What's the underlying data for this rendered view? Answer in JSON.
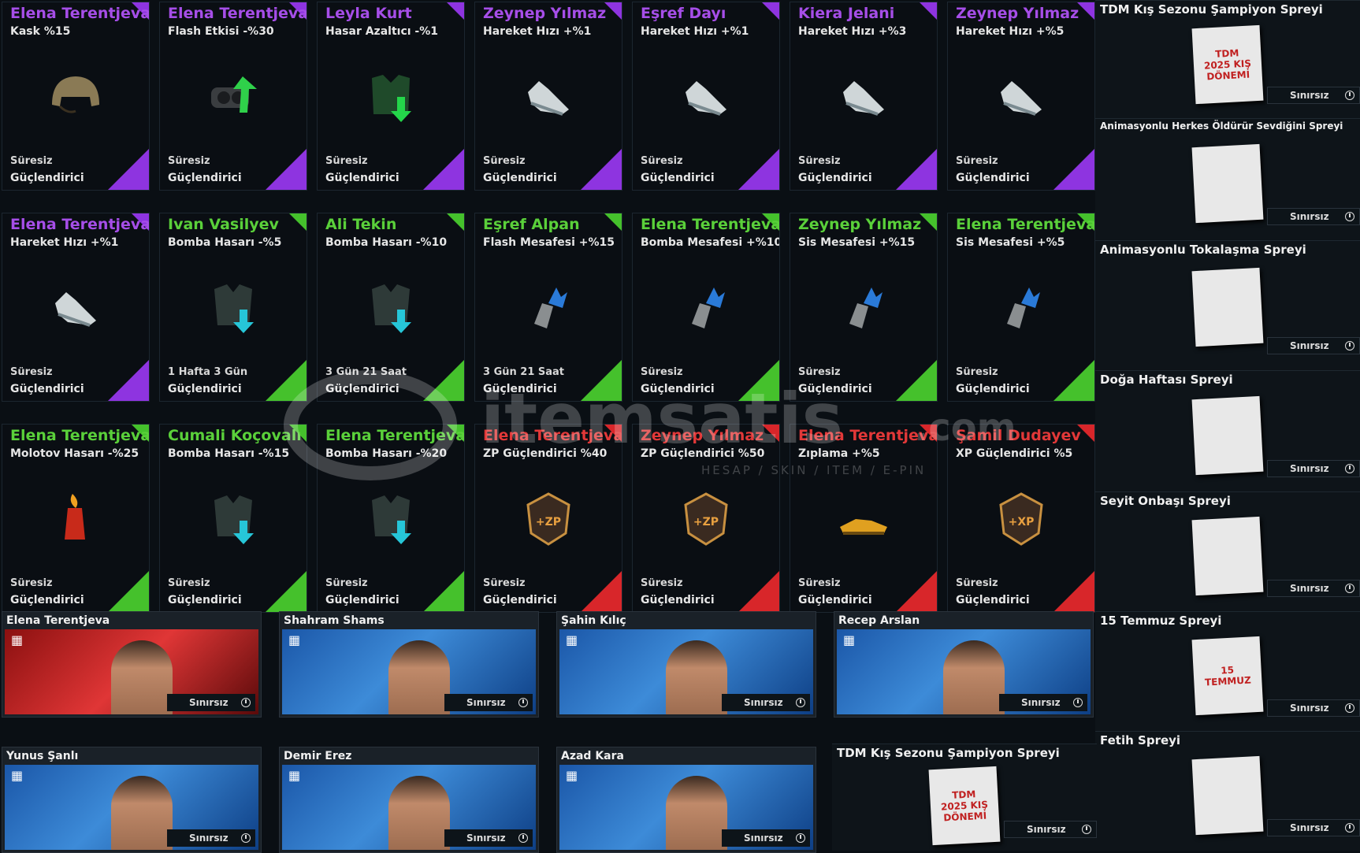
{
  "cards": [
    {
      "owner": "Elena Terentjeva",
      "stat": "Kask %15",
      "duration": "Süresiz",
      "type": "Güçlendirici",
      "rarity": "purple",
      "icon": "helmet-icon"
    },
    {
      "owner": "Elena Terentjeva",
      "stat": "Flash Etkisi -%30",
      "duration": "Süresiz",
      "type": "Güçlendirici",
      "rarity": "purple",
      "icon": "goggles-icon"
    },
    {
      "owner": "Leyla Kurt",
      "stat": "Hasar Azaltıcı -%1",
      "duration": "Süresiz",
      "type": "Güçlendirici",
      "rarity": "purple",
      "icon": "vest-icon"
    },
    {
      "owner": "Zeynep Yılmaz",
      "stat": "Hareket Hızı +%1",
      "duration": "Süresiz",
      "type": "Güçlendirici",
      "rarity": "purple",
      "icon": "shoe-icon"
    },
    {
      "owner": "Eşref Dayı",
      "stat": "Hareket Hızı +%1",
      "duration": "Süresiz",
      "type": "Güçlendirici",
      "rarity": "purple",
      "icon": "shoe-icon"
    },
    {
      "owner": "Kiera Jelani",
      "stat": "Hareket Hızı +%3",
      "duration": "Süresiz",
      "type": "Güçlendirici",
      "rarity": "purple",
      "icon": "shoe-icon"
    },
    {
      "owner": "Zeynep Yılmaz",
      "stat": "Hareket Hızı +%5",
      "duration": "Süresiz",
      "type": "Güçlendirici",
      "rarity": "purple",
      "icon": "shoe-icon"
    },
    {
      "owner": "Elena Terentjeva",
      "stat": "Hareket Hızı +%1",
      "duration": "Süresiz",
      "type": "Güçlendirici",
      "rarity": "purple",
      "icon": "shoe-icon"
    },
    {
      "owner": "Ivan Vasilyev",
      "stat": "Bomba Hasarı -%5",
      "duration": "1 Hafta 3 Gün",
      "type": "Güçlendirici",
      "rarity": "green",
      "icon": "armor-icon"
    },
    {
      "owner": "Ali Tekin",
      "stat": "Bomba Hasarı -%10",
      "duration": "3 Gün 21 Saat",
      "type": "Güçlendirici",
      "rarity": "green",
      "icon": "armor-icon"
    },
    {
      "owner": "Eşref Alpan",
      "stat": "Flash Mesafesi +%15",
      "duration": "3 Gün 21 Saat",
      "type": "Güçlendirici",
      "rarity": "green",
      "icon": "grenade-icon"
    },
    {
      "owner": "Elena Terentjeva",
      "stat": "Bomba Mesafesi +%10",
      "duration": "Süresiz",
      "type": "Güçlendirici",
      "rarity": "green",
      "icon": "grenade-icon"
    },
    {
      "owner": "Zeynep Yılmaz",
      "stat": "Sis Mesafesi +%15",
      "duration": "Süresiz",
      "type": "Güçlendirici",
      "rarity": "green",
      "icon": "grenade-icon"
    },
    {
      "owner": "Elena Terentjeva",
      "stat": "Sis Mesafesi +%5",
      "duration": "Süresiz",
      "type": "Güçlendirici",
      "rarity": "green",
      "icon": "grenade-icon"
    },
    {
      "owner": "Elena Terentjeva",
      "stat": "Molotov Hasarı -%25",
      "duration": "Süresiz",
      "type": "Güçlendirici",
      "rarity": "green",
      "icon": "molotov-icon"
    },
    {
      "owner": "Cumali Koçovalı",
      "stat": "Bomba Hasarı -%15",
      "duration": "Süresiz",
      "type": "Güçlendirici",
      "rarity": "green",
      "icon": "armor-icon"
    },
    {
      "owner": "Elena Terentjeva",
      "stat": "Bomba Hasarı -%20",
      "duration": "Süresiz",
      "type": "Güçlendirici",
      "rarity": "green",
      "icon": "armor-icon"
    },
    {
      "owner": "Elena Terentjeva",
      "stat": "ZP Güçlendirici %40",
      "duration": "Süresiz",
      "type": "Güçlendirici",
      "rarity": "red",
      "icon": "zp-badge-icon"
    },
    {
      "owner": "Zeynep Yılmaz",
      "stat": "ZP Güçlendirici %50",
      "duration": "Süresiz",
      "type": "Güçlendirici",
      "rarity": "red",
      "icon": "zp-badge-icon"
    },
    {
      "owner": "Elena Terentjeva",
      "stat": "Zıplama +%5",
      "duration": "Süresiz",
      "type": "Güçlendirici",
      "rarity": "red",
      "icon": "gold-shoe-icon"
    },
    {
      "owner": "Şamil Dudayev",
      "stat": "XP Güçlendirici %5",
      "duration": "Süresiz",
      "type": "Güçlendirici",
      "rarity": "red",
      "icon": "xp-badge-icon"
    }
  ],
  "characters": [
    {
      "name": "Elena Terentjeva",
      "duration": "Sınırsız"
    },
    {
      "name": "Shahram Shams",
      "duration": "Sınırsız"
    },
    {
      "name": "Şahin Kılıç",
      "duration": "Sınırsız"
    },
    {
      "name": "Recep Arslan",
      "duration": "Sınırsız"
    },
    {
      "name": "Yunus Şanlı",
      "duration": "Sınırsız"
    },
    {
      "name": "Demir Erez",
      "duration": "Sınırsız"
    },
    {
      "name": "Azad Kara",
      "duration": "Sınırsız"
    }
  ],
  "bottom_spray": {
    "name": "TDM Kış Sezonu Şampiyon Spreyi",
    "duration": "Sınırsız",
    "art_text": "TDM 2025 KIŞ DÖNEMİ"
  },
  "sprays": [
    {
      "name": "TDM Kış Sezonu Şampiyon Spreyi",
      "duration": "Sınırsız",
      "art_text": "TDM 2025 KIŞ DÖNEMİ"
    },
    {
      "name": "Animasyonlu Herkes Öldürür Sevdiğini Spreyi",
      "duration": "Sınırsız",
      "art_text": ""
    },
    {
      "name": "Animasyonlu Tokalaşma Spreyi",
      "duration": "Sınırsız",
      "art_text": ""
    },
    {
      "name": "Doğa Haftası Spreyi",
      "duration": "Sınırsız",
      "art_text": ""
    },
    {
      "name": "Seyit Onbaşı Spreyi",
      "duration": "Sınırsız",
      "art_text": ""
    },
    {
      "name": "15 Temmuz Spreyi",
      "duration": "Sınırsız",
      "art_text": "15 TEMMUZ"
    },
    {
      "name": "Fetih Spreyi",
      "duration": "Sınırsız",
      "art_text": ""
    }
  ],
  "watermark": {
    "brand": "itemsatis",
    "domain": ".com",
    "tagline": "HESAP / SKIN / ITEM / E-PIN"
  }
}
